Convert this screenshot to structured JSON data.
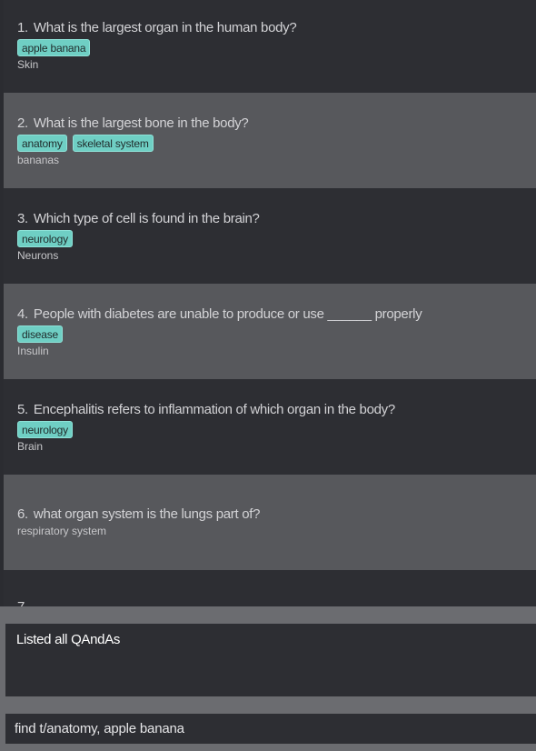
{
  "qa_list": [
    {
      "index": "1.",
      "question": "What is the largest organ in the human body?",
      "tags": [
        "apple banana"
      ],
      "answer": "Skin"
    },
    {
      "index": "2.",
      "question": "What is the largest bone in the body?",
      "tags": [
        "anatomy",
        "skeletal system"
      ],
      "answer": "bananas"
    },
    {
      "index": "3.",
      "question": "Which type of cell is found in the brain?",
      "tags": [
        "neurology"
      ],
      "answer": "Neurons"
    },
    {
      "index": "4.",
      "question": "People with diabetes are unable to produce or use ______ properly",
      "tags": [
        "disease"
      ],
      "answer": "Insulin"
    },
    {
      "index": "5.",
      "question": "Encephalitis refers to inflammation of which organ in the body?",
      "tags": [
        "neurology"
      ],
      "answer": "Brain"
    },
    {
      "index": "6.",
      "question": "what organ system is the lungs part of?",
      "tags": [],
      "answer": "respiratory system"
    },
    {
      "index": "7.",
      "question": "",
      "tags": [],
      "answer": ""
    }
  ],
  "result": {
    "text": "Listed all QAndAs"
  },
  "command": {
    "value": "find t/anatomy, apple banana"
  },
  "colors": {
    "card_dark": "#2d2e33",
    "card_light": "#57585c",
    "tag_bg": "#6fcfc4",
    "background": "#6b6c70"
  }
}
